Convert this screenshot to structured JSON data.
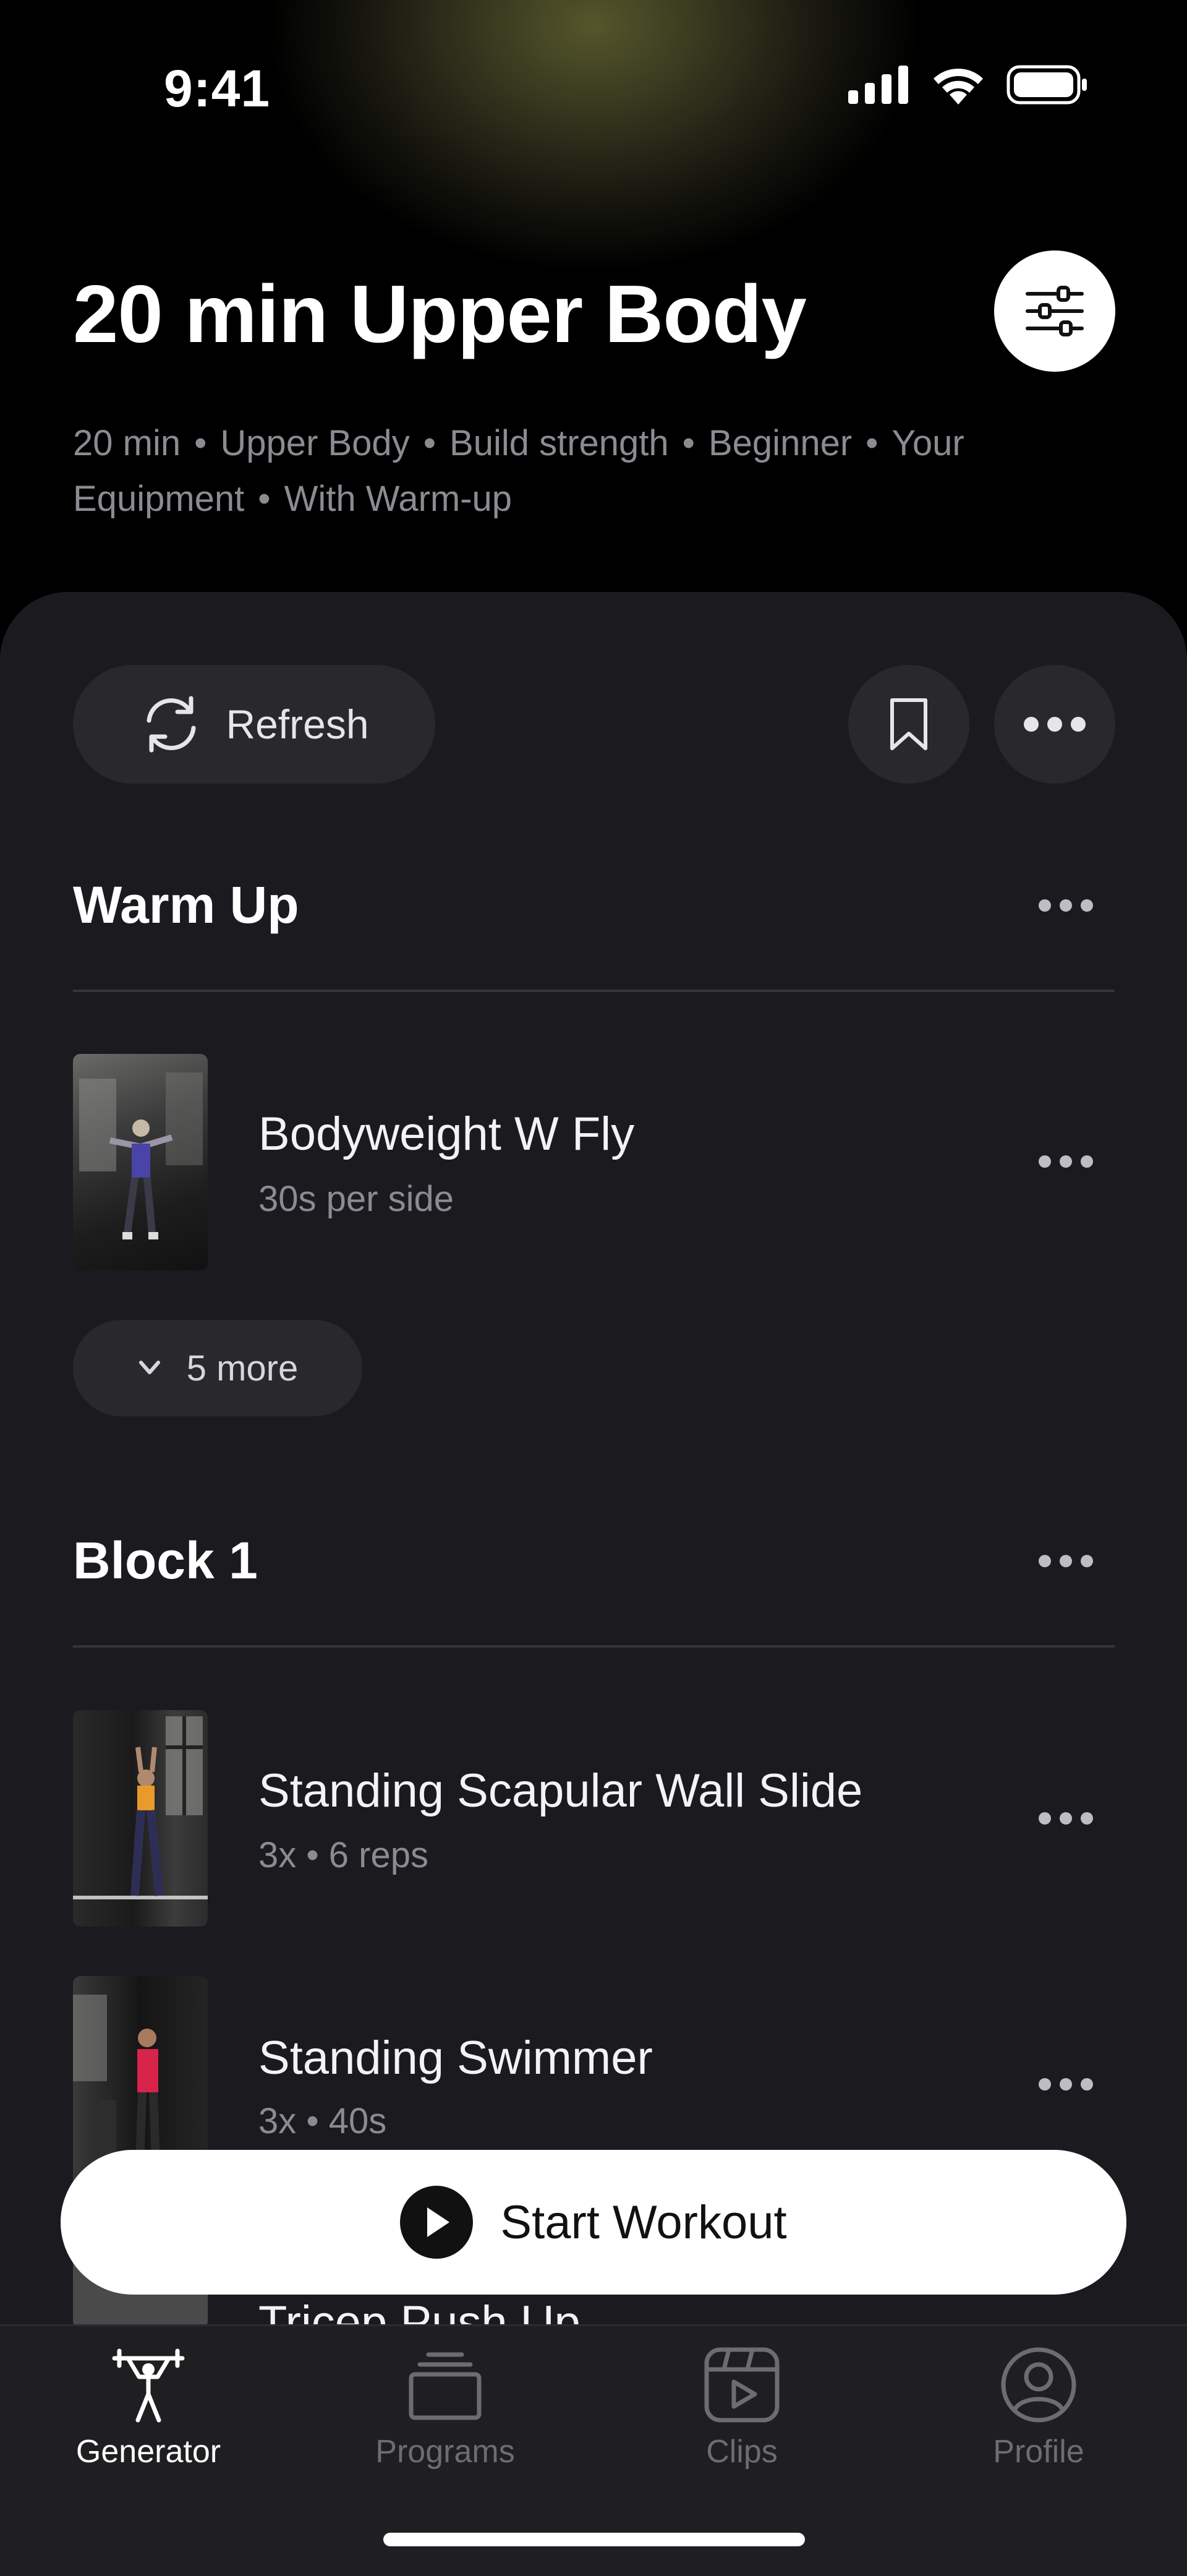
{
  "status_bar": {
    "time": "9:41"
  },
  "header": {
    "title": "20 min Upper Body",
    "tags": [
      "20 min",
      "Upper Body",
      "Build strength",
      "Beginner",
      "Your Equipment",
      "With Warm-up"
    ]
  },
  "actions": {
    "refresh_label": "Refresh"
  },
  "sections": {
    "warmup": {
      "title": "Warm Up",
      "exercise": {
        "name": "Bodyweight W Fly",
        "detail": "30s per side"
      },
      "more_label": "5 more"
    },
    "block1": {
      "title": "Block 1",
      "exercises": [
        {
          "name": "Standing Scapular Wall Slide",
          "detail": "3x • 6 reps"
        },
        {
          "name": "Standing Swimmer",
          "detail": "3x • 40s"
        },
        {
          "name": "Tricep Push Up",
          "detail": ""
        }
      ]
    }
  },
  "start_button": {
    "label": "Start Workout"
  },
  "tabbar": {
    "tabs": [
      {
        "label": "Generator",
        "icon": "weightlifter-icon",
        "active": true
      },
      {
        "label": "Programs",
        "icon": "stack-icon",
        "active": false
      },
      {
        "label": "Clips",
        "icon": "video-clip-icon",
        "active": false
      },
      {
        "label": "Profile",
        "icon": "profile-icon",
        "active": false
      }
    ]
  },
  "colors": {
    "sheet_bg": "#1a1a1f",
    "pill_bg": "#28282d",
    "muted_text": "#8b8b92",
    "accent_glow": "#55562a"
  }
}
